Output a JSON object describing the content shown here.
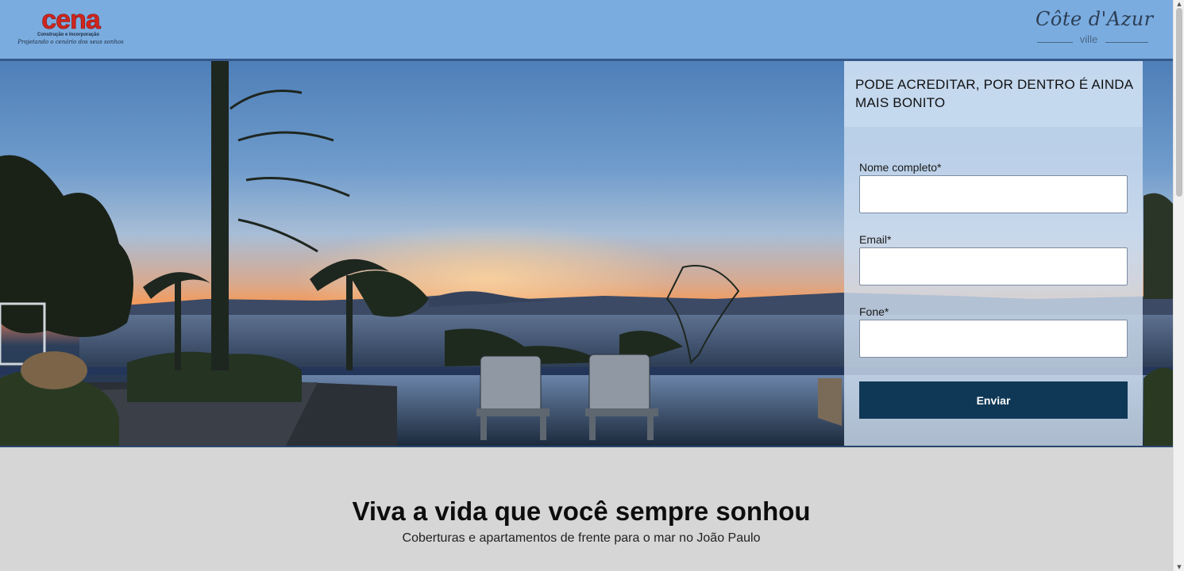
{
  "header": {
    "logo_left": {
      "word": "cena",
      "line1": "Construção e Incorporação",
      "line2": "Projetando o cenário dos seus sonhos"
    },
    "logo_right": {
      "script": "Côte d'Azur",
      "sub": "ville"
    }
  },
  "form": {
    "title": "PODE ACREDITAR, POR DENTRO É AINDA MAIS BONITO",
    "fields": [
      {
        "label": "Nome completo*",
        "value": ""
      },
      {
        "label": "Email*",
        "value": ""
      },
      {
        "label": "Fone*",
        "value": ""
      }
    ],
    "submit_label": "Enviar"
  },
  "section": {
    "headline": "Viva a vida que você sempre sonhou",
    "subheadline": "Coberturas e apartamentos de frente para o mar no João Paulo"
  },
  "colors": {
    "header_bg": "#7aace0",
    "button_bg": "#0f3856",
    "logo_red": "#d0261d"
  }
}
